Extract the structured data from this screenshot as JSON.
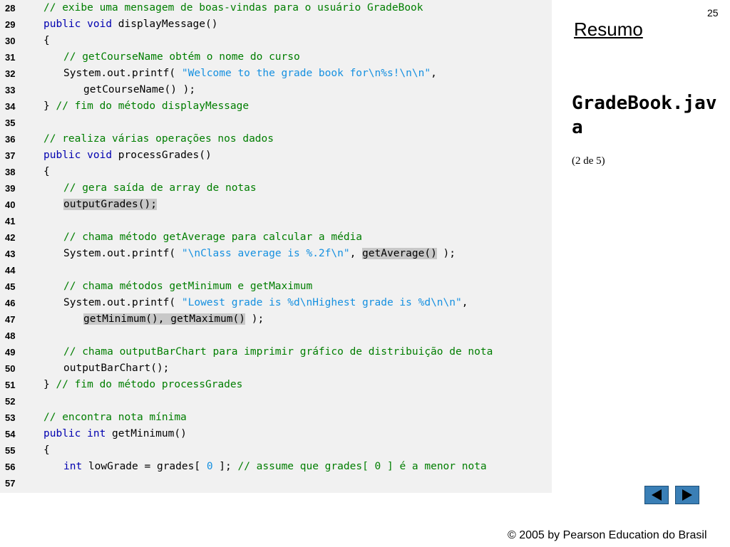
{
  "page_number": "25",
  "side": {
    "resumo_label": "Resumo",
    "file_title": "GradeBook.java",
    "part_info": "(2 de 5)"
  },
  "footer": {
    "copyright": "© 2005 by Pearson Education do Brasil"
  },
  "nav": {
    "prev_icon": "left-triangle-icon",
    "next_icon": "right-triangle-icon"
  },
  "colors": {
    "keyword": "#0000b0",
    "comment": "#007e00",
    "string": "#1590e0",
    "highlight": "#c8c8c8",
    "panel": "#f1f1f1",
    "nav_button": "#3a7fb6"
  },
  "code_lines": [
    {
      "n": "28",
      "indent": 0,
      "tokens": [
        {
          "t": "// exibe uma mensagem de boas-vindas para o usuário GradeBook",
          "c": "cmt"
        }
      ]
    },
    {
      "n": "29",
      "indent": 0,
      "tokens": [
        {
          "t": "public",
          "c": "kw"
        },
        {
          "t": " ",
          "c": "plain"
        },
        {
          "t": "void",
          "c": "kw"
        },
        {
          "t": " displayMessage()",
          "c": "plain"
        }
      ]
    },
    {
      "n": "30",
      "indent": 0,
      "tokens": [
        {
          "t": "{",
          "c": "plain"
        }
      ]
    },
    {
      "n": "31",
      "indent": 1,
      "tokens": [
        {
          "t": "// getCourseName obtém o nome do curso",
          "c": "cmt"
        }
      ]
    },
    {
      "n": "32",
      "indent": 1,
      "tokens": [
        {
          "t": "System.out.printf( ",
          "c": "plain"
        },
        {
          "t": "\"Welcome to the grade book for\\n%s!\\n\\n\"",
          "c": "str"
        },
        {
          "t": ",",
          "c": "plain"
        }
      ]
    },
    {
      "n": "33",
      "indent": 2,
      "tokens": [
        {
          "t": "getCourseName() );",
          "c": "plain"
        }
      ]
    },
    {
      "n": "34",
      "indent": 0,
      "tokens": [
        {
          "t": "} ",
          "c": "plain"
        },
        {
          "t": "// fim do método displayMessage",
          "c": "cmt"
        }
      ]
    },
    {
      "n": "35",
      "indent": 0,
      "tokens": []
    },
    {
      "n": "36",
      "indent": 0,
      "tokens": [
        {
          "t": "// realiza várias operações nos dados",
          "c": "cmt"
        }
      ]
    },
    {
      "n": "37",
      "indent": 0,
      "tokens": [
        {
          "t": "public",
          "c": "kw"
        },
        {
          "t": " ",
          "c": "plain"
        },
        {
          "t": "void",
          "c": "kw"
        },
        {
          "t": " processGrades()",
          "c": "plain"
        }
      ]
    },
    {
      "n": "38",
      "indent": 0,
      "tokens": [
        {
          "t": "{",
          "c": "plain"
        }
      ]
    },
    {
      "n": "39",
      "indent": 1,
      "tokens": [
        {
          "t": "// gera saída de array de notas",
          "c": "cmt"
        }
      ]
    },
    {
      "n": "40",
      "indent": 1,
      "tokens": [
        {
          "t": "outputGrades();",
          "c": "hl"
        }
      ]
    },
    {
      "n": "41",
      "indent": 0,
      "tokens": []
    },
    {
      "n": "42",
      "indent": 1,
      "tokens": [
        {
          "t": "// chama método getAverage para calcular a média",
          "c": "cmt"
        }
      ]
    },
    {
      "n": "43",
      "indent": 1,
      "tokens": [
        {
          "t": "System.out.printf( ",
          "c": "plain"
        },
        {
          "t": "\"\\nClass average is %.2f\\n\"",
          "c": "str"
        },
        {
          "t": ", ",
          "c": "plain"
        },
        {
          "t": "getAverage()",
          "c": "hl"
        },
        {
          "t": " );",
          "c": "plain"
        }
      ]
    },
    {
      "n": "44",
      "indent": 0,
      "tokens": []
    },
    {
      "n": "45",
      "indent": 1,
      "tokens": [
        {
          "t": "// chama métodos getMinimum e getMaximum",
          "c": "cmt"
        }
      ]
    },
    {
      "n": "46",
      "indent": 1,
      "tokens": [
        {
          "t": "System.out.printf( ",
          "c": "plain"
        },
        {
          "t": "\"Lowest grade is %d\\nHighest grade is %d\\n\\n\"",
          "c": "str"
        },
        {
          "t": ",",
          "c": "plain"
        }
      ]
    },
    {
      "n": "47",
      "indent": 2,
      "tokens": [
        {
          "t": "getMinimum(), getMaximum()",
          "c": "hl"
        },
        {
          "t": " );",
          "c": "plain"
        }
      ]
    },
    {
      "n": "48",
      "indent": 0,
      "tokens": []
    },
    {
      "n": "49",
      "indent": 1,
      "tokens": [
        {
          "t": "// chama outputBarChart para imprimir gráfico de distribuição de nota",
          "c": "cmt"
        }
      ]
    },
    {
      "n": "50",
      "indent": 1,
      "tokens": [
        {
          "t": "outputBarChart();",
          "c": "plain"
        }
      ]
    },
    {
      "n": "51",
      "indent": 0,
      "tokens": [
        {
          "t": "} ",
          "c": "plain"
        },
        {
          "t": "// fim do método processGrades",
          "c": "cmt"
        }
      ]
    },
    {
      "n": "52",
      "indent": 0,
      "tokens": []
    },
    {
      "n": "53",
      "indent": 0,
      "tokens": [
        {
          "t": "// encontra nota mínima",
          "c": "cmt"
        }
      ]
    },
    {
      "n": "54",
      "indent": 0,
      "tokens": [
        {
          "t": "public",
          "c": "kw"
        },
        {
          "t": " ",
          "c": "plain"
        },
        {
          "t": "int",
          "c": "kw"
        },
        {
          "t": " getMinimum()",
          "c": "plain"
        }
      ]
    },
    {
      "n": "55",
      "indent": 0,
      "tokens": [
        {
          "t": "{",
          "c": "plain"
        }
      ]
    },
    {
      "n": "56",
      "indent": 1,
      "tokens": [
        {
          "t": "int",
          "c": "kw"
        },
        {
          "t": " lowGrade = grades[ ",
          "c": "plain"
        },
        {
          "t": "0",
          "c": "num"
        },
        {
          "t": " ]; ",
          "c": "plain"
        },
        {
          "t": "// assume que grades[ 0 ] é a menor nota",
          "c": "cmt"
        }
      ]
    },
    {
      "n": "57",
      "indent": 0,
      "tokens": []
    }
  ]
}
